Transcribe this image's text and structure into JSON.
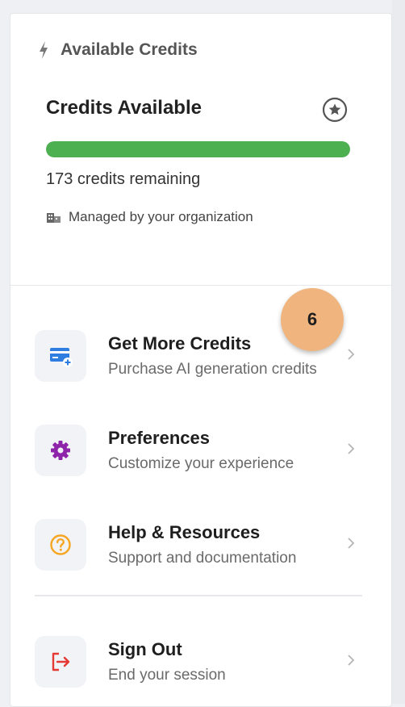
{
  "credits": {
    "section_title": "Available Credits",
    "card_title": "Credits Available",
    "remaining_text": "173 credits remaining",
    "managed_text": "Managed by your organization",
    "progress_fraction": 1.0,
    "progress_color": "#4caf50"
  },
  "menu": [
    {
      "title": "Get More Credits",
      "subtitle": "Purchase AI generation credits",
      "icon": "credit-card-plus-icon",
      "color": "#2f7de1"
    },
    {
      "title": "Preferences",
      "subtitle": "Customize your experience",
      "icon": "gear-icon",
      "color": "#8e24aa"
    },
    {
      "title": "Help & Resources",
      "subtitle": "Support and documentation",
      "icon": "help-circle-icon",
      "color": "#f5a623"
    },
    {
      "title": "Sign Out",
      "subtitle": "End your session",
      "icon": "sign-out-icon",
      "color": "#e53935"
    }
  ],
  "badge": {
    "number": "6"
  }
}
